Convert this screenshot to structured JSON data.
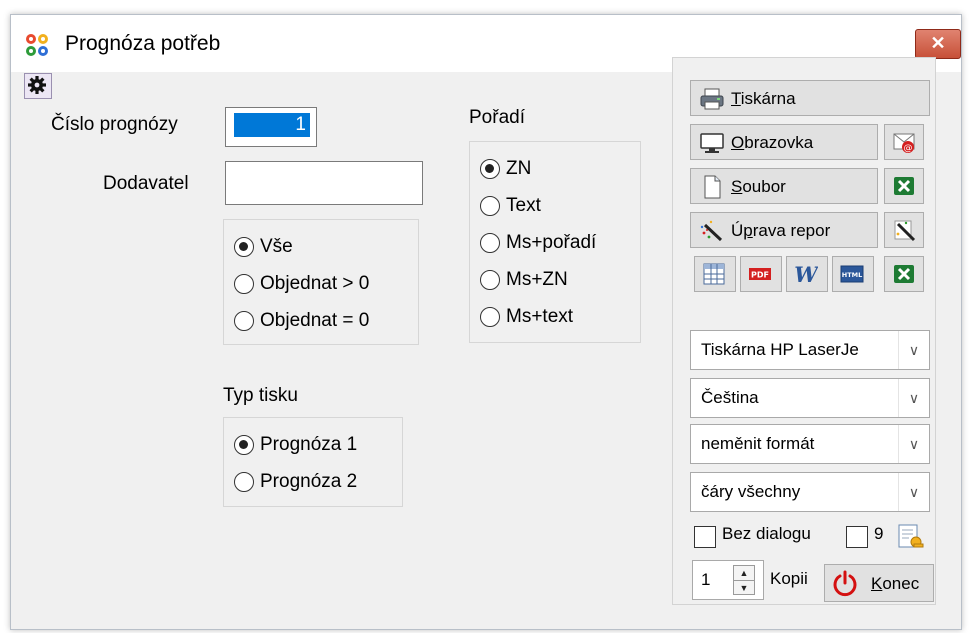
{
  "window": {
    "title": "Prognóza potřeb",
    "close_glyph": "✕"
  },
  "form": {
    "cislo_label": "Číslo prognózy",
    "cislo_value": "1",
    "dodavatel_label": "Dodavatel",
    "dodavatel_value": "",
    "filter_options": [
      {
        "label": "Vše",
        "checked": true
      },
      {
        "label": "Objednat > 0",
        "checked": false
      },
      {
        "label": "Objednat = 0",
        "checked": false
      }
    ],
    "poradi_label": "Pořadí",
    "poradi_options": [
      {
        "label": "ZN",
        "checked": true
      },
      {
        "label": "Text",
        "checked": false
      },
      {
        "label": "Ms+pořadí",
        "checked": false
      },
      {
        "label": "Ms+ZN",
        "checked": false
      },
      {
        "label": "Ms+text",
        "checked": false
      }
    ],
    "typ_label": "Typ tisku",
    "typ_options": [
      {
        "label": "Prognóza 1",
        "checked": true
      },
      {
        "label": "Prognóza 2",
        "checked": false
      }
    ]
  },
  "panel": {
    "tiskarna_first": "T",
    "tiskarna_rest": "iskárna",
    "obrazovka_first": "O",
    "obrazovka_rest": "brazovka",
    "soubor_first": "S",
    "soubor_rest": "oubor",
    "uprava_first": "Ú",
    "uprava_second": "p",
    "uprava_rest": "rava repor",
    "printer": "Tiskárna HP LaserJe",
    "language": "Čeština",
    "format": "neměnit formát",
    "lines": "čáry všechny",
    "bez_dialogu": "Bez dialogu",
    "nine_label": "9",
    "copies_value": "1",
    "copies_label": "Kopii",
    "konec_first": "K",
    "konec_rest": "onec",
    "pdf_label": "PDF",
    "html_label": "HTML",
    "word_glyph": "W"
  },
  "colors": {
    "selection": "#0078d7",
    "close": "#c75038",
    "excel": "#1e7b34",
    "pdf": "#d42020",
    "word": "#2b579a",
    "power": "#d41010"
  }
}
